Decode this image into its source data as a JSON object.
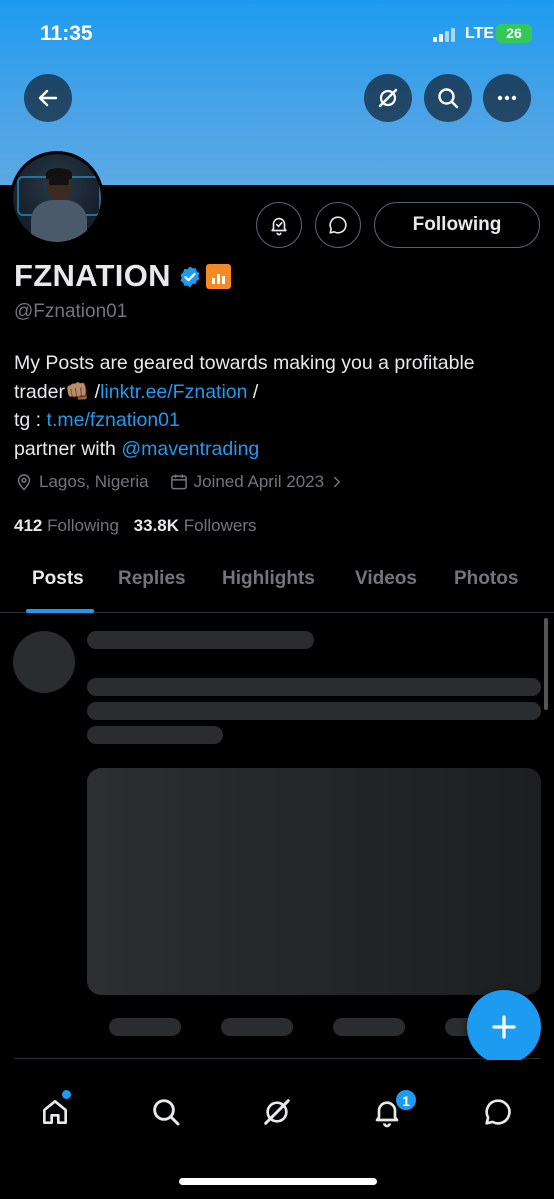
{
  "status_bar": {
    "time": "11:35",
    "network": "LTE",
    "battery": "26"
  },
  "profile": {
    "display_name": "FZNATION",
    "handle": "@Fznation01",
    "following_button": "Following",
    "bio": {
      "line1": "My Posts are geared towards making you a profitable",
      "line2_text": "trader👊🏽 /",
      "line2_link": "linktr.ee/Fznation",
      "line2_tail": " /",
      "line3_text": "tg : ",
      "line3_link": "t.me/fznation01",
      "line4_text": "partner with ",
      "line4_link": "@maventrading"
    },
    "location": "Lagos, Nigeria",
    "joined": "Joined April 2023",
    "following_count": "412",
    "following_label": "Following",
    "followers_count": "33.8K",
    "followers_label": "Followers"
  },
  "tabs": [
    {
      "label": "Posts",
      "active": true
    },
    {
      "label": "Replies"
    },
    {
      "label": "Highlights"
    },
    {
      "label": "Videos"
    },
    {
      "label": "Photos"
    }
  ],
  "bottom_nav": {
    "notification_count": "1"
  },
  "colors": {
    "accent": "#1d9bf0",
    "background": "#000000",
    "muted": "#71767b",
    "affiliate": "#f58a25"
  },
  "icons": {
    "header": [
      "back-arrow-icon",
      "grok-icon",
      "search-icon",
      "more-icon"
    ],
    "actions": [
      "notification-bell-icon",
      "message-icon"
    ],
    "nav": [
      "home-icon",
      "search-icon",
      "grok-icon",
      "notifications-icon",
      "messages-icon"
    ]
  }
}
